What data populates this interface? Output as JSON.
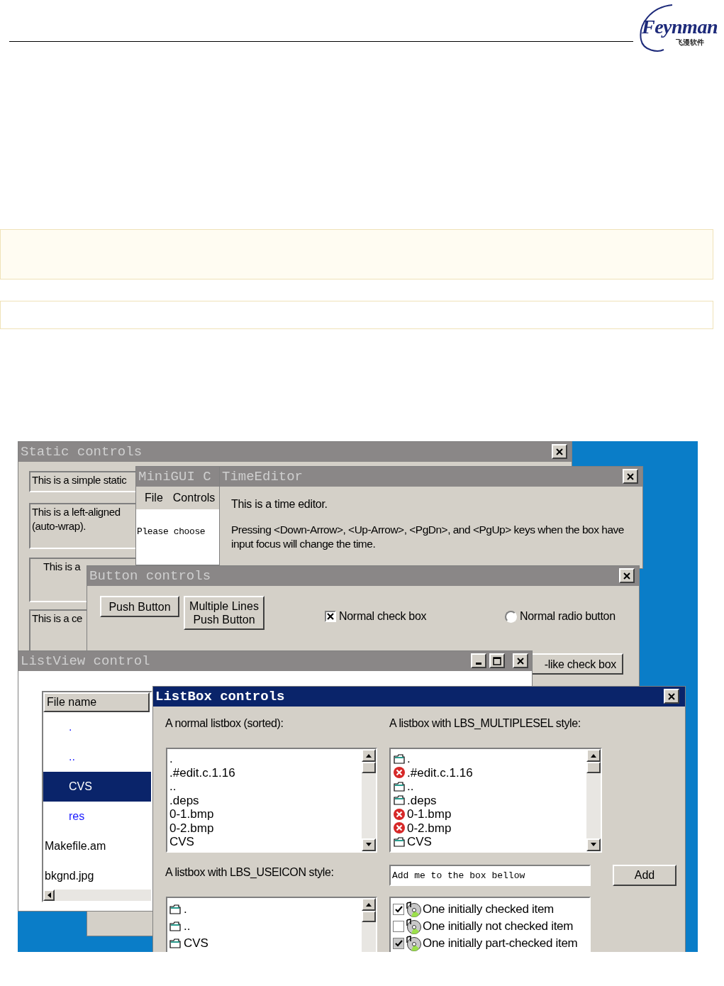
{
  "page_header": {
    "logo_text": "Feynman",
    "logo_tagline": "飞漫软件"
  },
  "static_window": {
    "title": "Static controls",
    "active": false,
    "statics": [
      {
        "lines": [
          "This is a simple static"
        ],
        "kind": "left"
      },
      {
        "lines": [
          "This is a left-aligned",
          "(auto-wrap)."
        ],
        "kind": "left"
      },
      {
        "lines": [
          "This is a"
        ],
        "kind": "right"
      },
      {
        "lines": [
          "This is a ce"
        ],
        "kind": "left"
      }
    ]
  },
  "minigui_window": {
    "title": "MiniGUI C",
    "active": false,
    "menu": [
      "File",
      "Controls"
    ],
    "text": "Please choose"
  },
  "timeeditor_window": {
    "title": "TimeEditor",
    "active": false,
    "text": "This is a time editor.",
    "paragraph": "Pressing <Down-Arrow>, <Up-Arrow>, <PgDn>, and <PgUp> keys when the box have input focus will change the time."
  },
  "button_window": {
    "title": "Button controls",
    "active": false,
    "buttons": [
      "Push Button",
      "Multiple Lines Push Button"
    ],
    "check": {
      "label": "Normal check box",
      "checked": true
    },
    "radio": {
      "label": "Normal radio button",
      "selected": false
    },
    "pushlike": {
      "label": "-like check box"
    }
  },
  "listview_window": {
    "title": "ListView control",
    "active": false,
    "column": "File name",
    "rows": [
      {
        "name": ".",
        "kind": "folder",
        "selected": false
      },
      {
        "name": "..",
        "kind": "folder",
        "selected": false
      },
      {
        "name": "CVS",
        "kind": "folder",
        "selected": true
      },
      {
        "name": "res",
        "kind": "folder",
        "selected": false
      },
      {
        "name": "Makefile.am",
        "kind": "file",
        "selected": false
      },
      {
        "name": "bkgnd.jpg",
        "kind": "file",
        "selected": false
      }
    ]
  },
  "listbox_window": {
    "title": "ListBox controls",
    "active": true,
    "label_sorted": "A normal listbox (sorted):",
    "label_multi": "A listbox with LBS_MULTIPLESEL style:",
    "label_icon": "A listbox with LBS_USEICON style:",
    "sorted_items": [
      ".",
      ".#edit.c.1.16",
      "..",
      ".deps",
      "0-1.bmp",
      "0-2.bmp",
      "CVS"
    ],
    "multi_items": [
      {
        "name": ".",
        "kind": "folder"
      },
      {
        "name": ".#edit.c.1.16",
        "kind": "error"
      },
      {
        "name": "..",
        "kind": "folder"
      },
      {
        "name": ".deps",
        "kind": "folder"
      },
      {
        "name": "0-1.bmp",
        "kind": "error"
      },
      {
        "name": "0-2.bmp",
        "kind": "error"
      },
      {
        "name": "CVS",
        "kind": "folder"
      }
    ],
    "edit_value": "Add me to the box bellow",
    "add_button": "Add",
    "icon_items": [
      {
        "name": ".",
        "kind": "folder"
      },
      {
        "name": "..",
        "kind": "folder"
      },
      {
        "name": "CVS",
        "kind": "folder"
      }
    ],
    "check_items": [
      {
        "name": "One initially checked item",
        "kind": "normal",
        "checked": true
      },
      {
        "name": "One initially not checked item",
        "kind": "normal",
        "checked": false
      },
      {
        "name": "One initially part-checked item",
        "kind": "partial",
        "checked": true
      }
    ]
  }
}
